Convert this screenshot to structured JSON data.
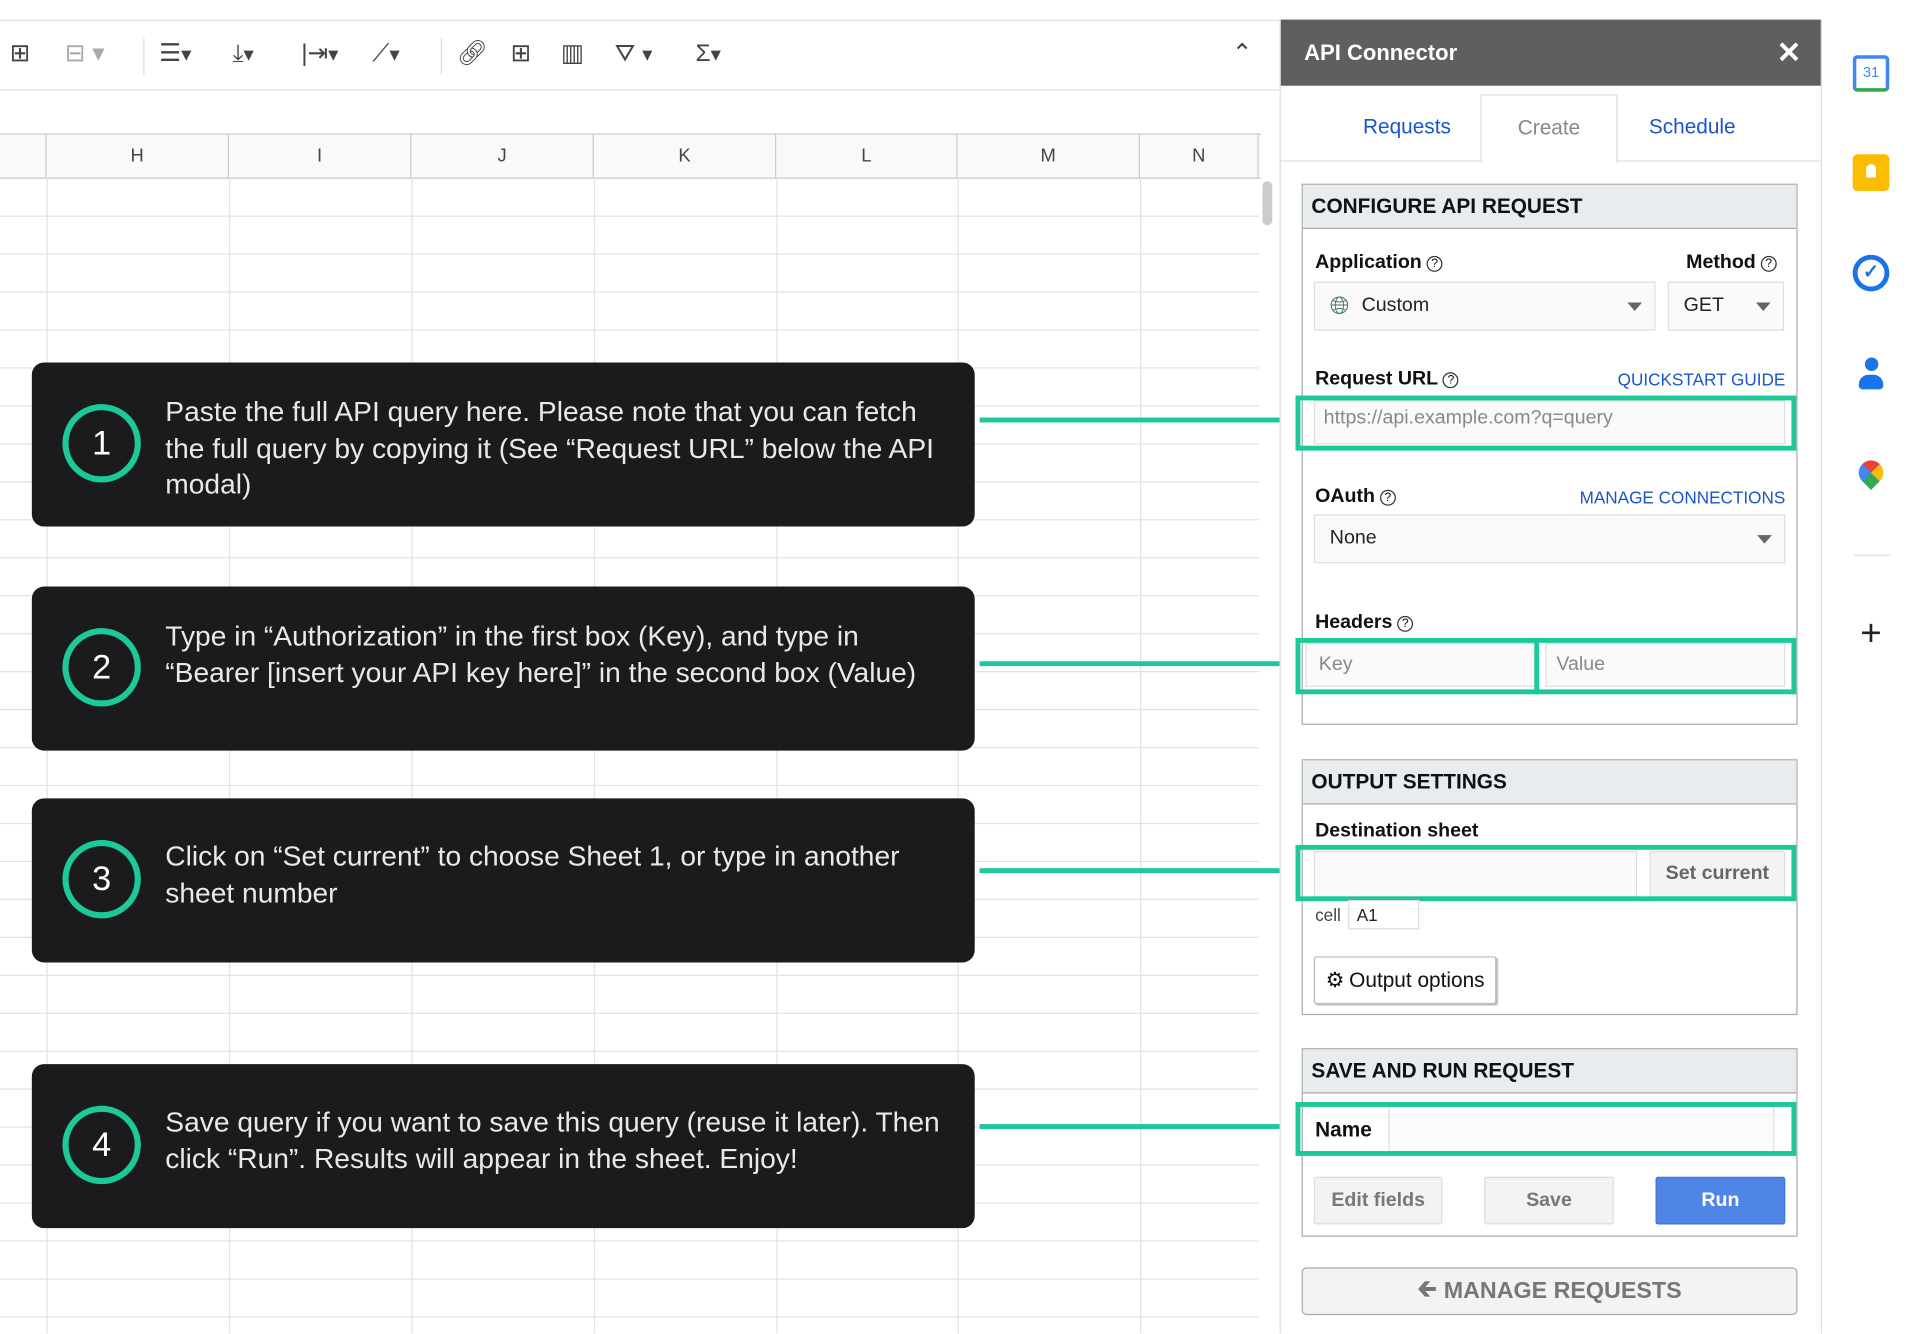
{
  "toolbar": {
    "icons": [
      "borders-icon",
      "merge-cells-icon",
      "horizontal-align-icon",
      "vertical-align-icon",
      "text-wrap-icon",
      "text-rotate-icon",
      "link-icon",
      "comment-icon",
      "chart-icon",
      "filter-icon",
      "functions-icon",
      "collapse-icon"
    ]
  },
  "sheet": {
    "columns": [
      "H",
      "I",
      "J",
      "K",
      "L",
      "M",
      "N"
    ]
  },
  "callouts": [
    {
      "num": "1",
      "text": "Paste the full API query here. Please note that you can fetch the full query by copying it (See “Request URL” below the API modal)"
    },
    {
      "num": "2",
      "text": "Type in “Authorization” in the first box (Key), and type in “Bearer [insert your API key here]” in the second box (Value)"
    },
    {
      "num": "3",
      "text": "Click on “Set current” to choose Sheet 1, or type in another sheet number"
    },
    {
      "num": "4",
      "text": "Save query if you want to save this query (reuse it later). Then click “Run”. Results will appear in the sheet. Enjoy!"
    }
  ],
  "highlight_color": "#1dc99a",
  "panel": {
    "title": "API Connector",
    "close": "✕",
    "tabs": [
      {
        "label": "Requests"
      },
      {
        "label": "Create",
        "active": true
      },
      {
        "label": "Schedule"
      }
    ],
    "configure": {
      "heading": "CONFIGURE API REQUEST",
      "application_label": "Application",
      "application_value": "Custom",
      "method_label": "Method",
      "method_value": "GET",
      "url_label": "Request URL",
      "quickstart": "QUICKSTART GUIDE",
      "url_placeholder": "https://api.example.com?q=query",
      "oauth_label": "OAuth",
      "manage_connections": "MANAGE CONNECTIONS",
      "oauth_value": "None",
      "headers_label": "Headers",
      "key_placeholder": "Key",
      "value_placeholder": "Value"
    },
    "output": {
      "heading": "OUTPUT SETTINGS",
      "dest_label": "Destination sheet",
      "set_current": "Set current",
      "cell_label": "cell",
      "cell_value": "A1",
      "output_options": "Output options"
    },
    "save": {
      "heading": "SAVE AND RUN REQUEST",
      "name_label": "Name",
      "edit_fields": "Edit fields",
      "save": "Save",
      "run": "Run"
    },
    "manage_requests": "MANAGE REQUESTS"
  },
  "right_sidebar": {
    "icons": [
      "calendar-icon",
      "keep-icon",
      "tasks-icon",
      "contacts-icon",
      "maps-icon",
      "add-icon"
    ],
    "calendar_day": "31"
  }
}
